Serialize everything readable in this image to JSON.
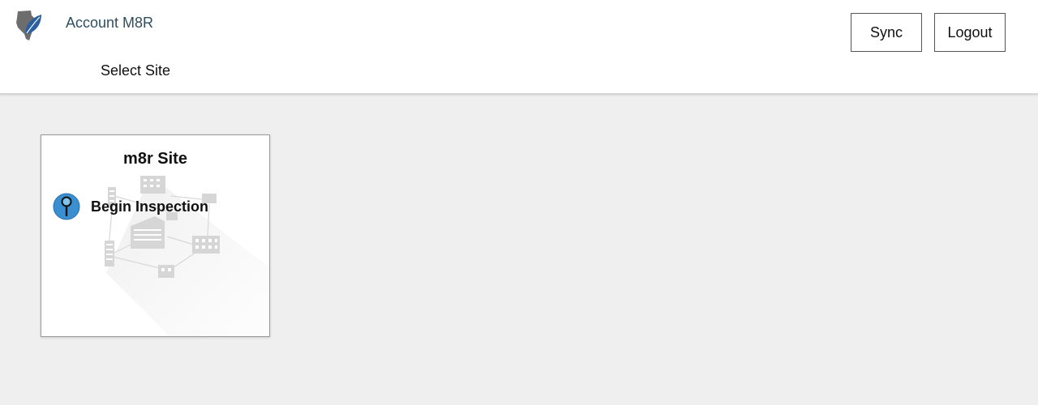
{
  "header": {
    "account_name": "Account M8R",
    "page_subtitle": "Select Site",
    "sync_label": "Sync",
    "logout_label": "Logout"
  },
  "sites": [
    {
      "name": "m8r Site",
      "action_label": "Begin Inspection",
      "action_icon": "magnifier-icon"
    }
  ],
  "colors": {
    "account_text": "#2f4f5f",
    "page_background": "#efefef",
    "icon_blue": "#3a8fd0",
    "logo_gray": "#6d6d6d",
    "logo_blue": "#2b5f9e"
  },
  "icons": {
    "logo": "state-leaf-logo-icon",
    "card_background": "building-network-illustration"
  }
}
